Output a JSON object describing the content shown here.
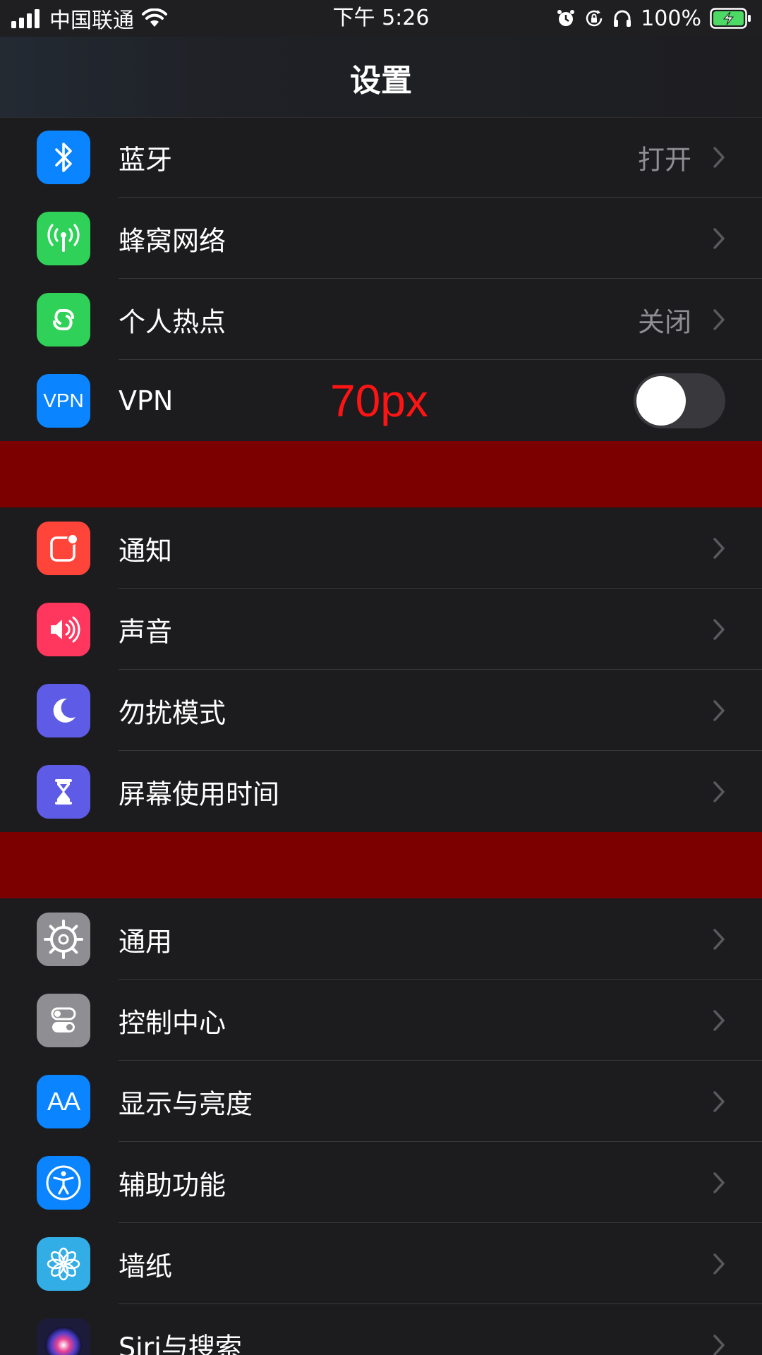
{
  "status_bar": {
    "carrier": "中国联通",
    "time": "下午 5:26",
    "battery_percent": "100%",
    "icons": [
      "signal-icon",
      "wifi-icon",
      "alarm-icon",
      "rotation-lock-icon",
      "headphones-icon",
      "battery-charging-icon"
    ]
  },
  "nav": {
    "title": "设置"
  },
  "annotation": "70px",
  "colors": {
    "background": "#1c1c1e",
    "band": "#7c0000",
    "value_gray": "#8e8e93",
    "annotation_red": "#ff1414"
  },
  "groups": [
    {
      "items": [
        {
          "label": "蓝牙",
          "value": "打开",
          "icon": "bluetooth-icon",
          "icon_bg": "#0a84ff"
        },
        {
          "label": "蜂窝网络",
          "value": "",
          "icon": "cellular-icon",
          "icon_bg": "#30d158"
        },
        {
          "label": "个人热点",
          "value": "关闭",
          "icon": "hotspot-icon",
          "icon_bg": "#30d158"
        },
        {
          "label": "VPN",
          "icon_text": "VPN",
          "icon": "vpn-icon",
          "icon_bg": "#0a84ff",
          "toggle_on": false
        }
      ]
    },
    {
      "items": [
        {
          "label": "通知",
          "icon": "notifications-icon",
          "icon_bg": "#ff453a"
        },
        {
          "label": "声音",
          "icon": "sound-icon",
          "icon_bg": "#ff375f"
        },
        {
          "label": "勿扰模式",
          "icon": "moon-icon",
          "icon_bg": "#5e5ce6"
        },
        {
          "label": "屏幕使用时间",
          "icon": "hourglass-icon",
          "icon_bg": "#5e5ce6"
        }
      ]
    },
    {
      "items": [
        {
          "label": "通用",
          "icon": "gear-icon",
          "icon_bg": "#8e8e93"
        },
        {
          "label": "控制中心",
          "icon": "control-center-icon",
          "icon_bg": "#8e8e93"
        },
        {
          "label": "显示与亮度",
          "icon_text": "AA",
          "icon": "display-icon",
          "icon_bg": "#0a84ff"
        },
        {
          "label": "辅助功能",
          "icon": "accessibility-icon",
          "icon_bg": "#0a84ff"
        },
        {
          "label": "墙纸",
          "icon": "wallpaper-icon",
          "icon_bg": "#32ade6"
        },
        {
          "label": "Siri与搜索",
          "icon": "siri-icon",
          "icon_bg": "#1c1c3a"
        }
      ]
    }
  ]
}
